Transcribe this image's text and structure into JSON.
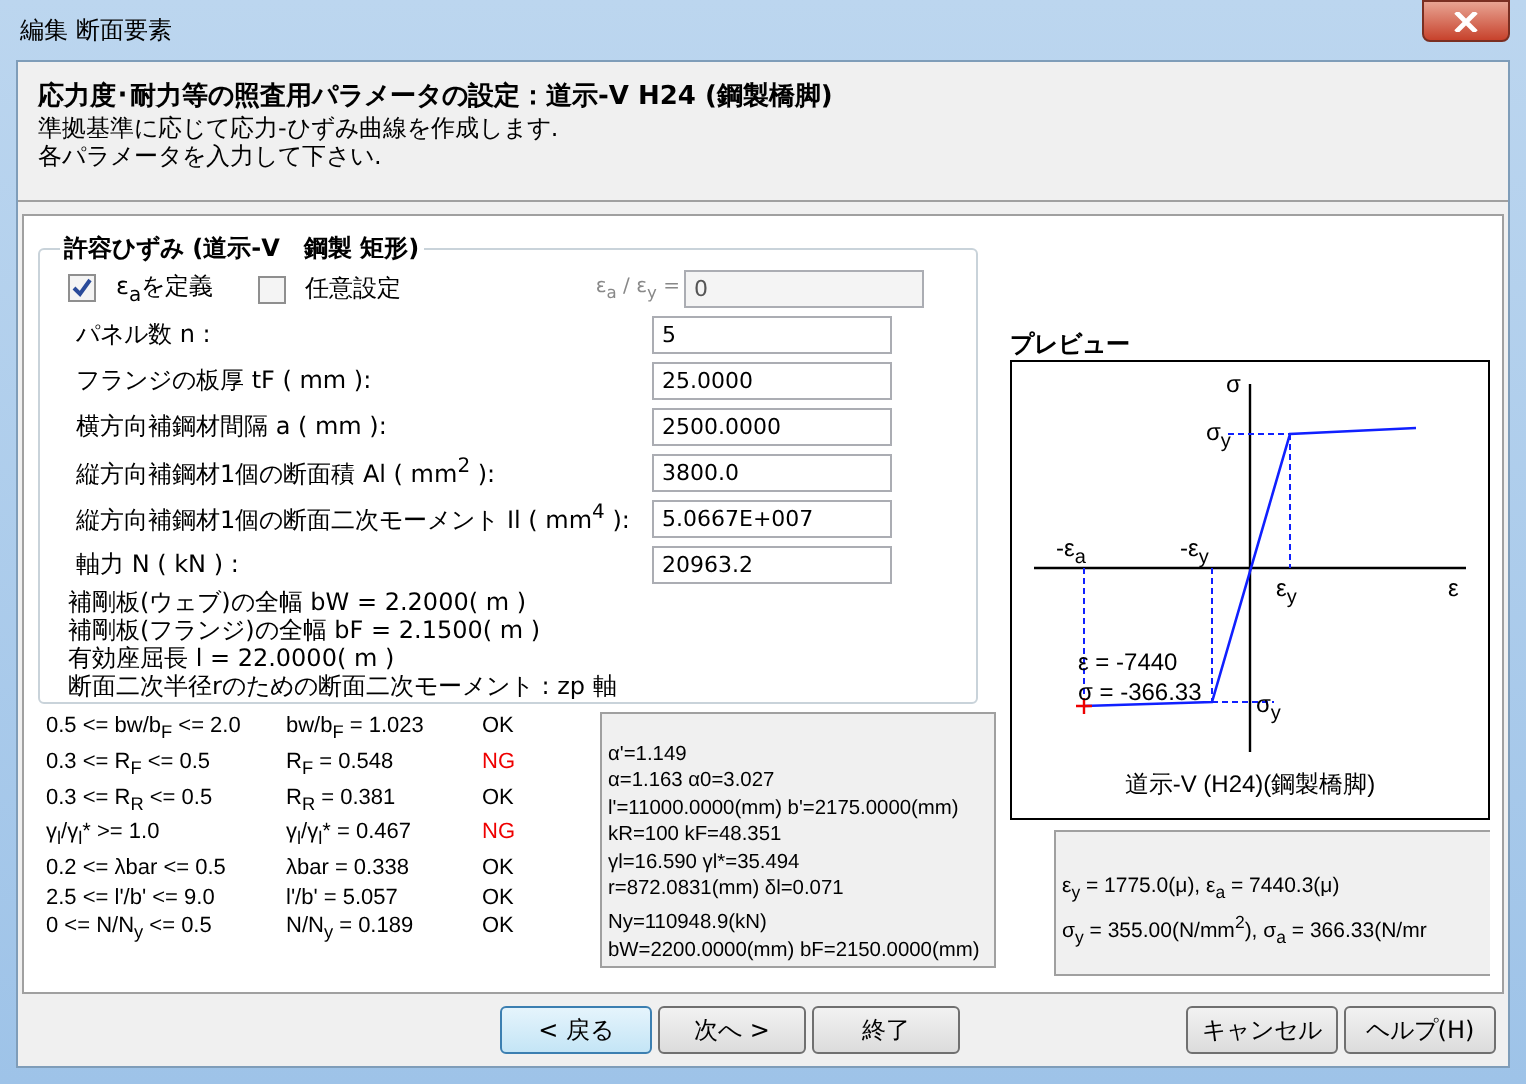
{
  "window": {
    "title": "編集 断面要素"
  },
  "header": {
    "title": "応力度･耐力等の照査用パラメータの設定：道示-V H24 (鋼製橋脚)",
    "lines": [
      "準拠基準に応じて応力-ひずみ曲線を作成します.",
      "各パラメータを入力して下さい."
    ]
  },
  "group": {
    "title": "許容ひずみ (道示-V　鋼製 矩形)",
    "options": [
      {
        "label": "ε$_{a}$を定義",
        "checked": true
      },
      {
        "label": "任意設定",
        "checked": false
      }
    ],
    "ratio": {
      "label": "ε$_{a}$ / ε$_{y}$ =",
      "value": "0",
      "disabled": true
    },
    "fields": [
      {
        "label": "パネル数 n :",
        "value": "5"
      },
      {
        "label": "フランジの板厚 tF ( mm ):",
        "value": "25.0000"
      },
      {
        "label": "横方向補鋼材間隔 a ( mm ):",
        "value": "2500.0000"
      },
      {
        "label": "縦方向補鋼材1個の断面積 Al ( mm$^{2}$ ):",
        "value": "3800.0"
      },
      {
        "label": "縦方向補鋼材1個の断面二次モーメント Il ( mm$^{4}$ ):",
        "value": "5.0667E+007"
      },
      {
        "label": "軸力 N ( kN ) :",
        "value": "20963.2"
      }
    ],
    "notes": [
      "補剛板(ウェブ)の全幅 bW = 2.2000( m )",
      "補剛板(フランジ)の全幅 bF = 2.1500( m )",
      "有効座屈長 l = 22.0000( m )",
      "断面二次半径rのための断面二次モーメント : zp 軸"
    ]
  },
  "checks": [
    {
      "condition": "0.5 <= bw/b$_{F}$ <= 2.0",
      "value": "bw/b$_{F}$ = 1.023",
      "result": "OK",
      "pass": true
    },
    {
      "condition": "0.3 <= R$_{F}$ <= 0.5",
      "value": "R$_{F}$ = 0.548",
      "result": "NG",
      "pass": false
    },
    {
      "condition": "0.3 <= R$_{R}$ <= 0.5",
      "value": "R$_{R}$ = 0.381",
      "result": "OK",
      "pass": true
    },
    {
      "condition": "γ$_{l}$/γ$_{l}$* >= 1.0",
      "value": "γ$_{l}$/γ$_{l}$* = 0.467",
      "result": "NG",
      "pass": false
    },
    {
      "condition": "0.2 <= λbar <= 0.5",
      "value": "λbar = 0.338",
      "result": "OK",
      "pass": true
    },
    {
      "condition": "2.5 <= l'/b' <= 9.0",
      "value": "l'/b' = 5.057",
      "result": "OK",
      "pass": true
    },
    {
      "condition": "0 <= N/N$_{y}$ <= 0.5",
      "value": "N/N$_{y}$ = 0.189",
      "result": "OK",
      "pass": true
    }
  ],
  "parameters": [
    "α'=1.149",
    "α=1.163 α0=3.027",
    "l'=11000.0000(mm) b'=2175.0000(mm)",
    "kR=100 kF=48.351",
    "γl=16.590 γl*=35.494",
    "r=872.0831(mm) δl=0.071",
    "Ny=110948.9(kN)",
    "bW=2200.0000(mm) bF=2150.0000(mm)"
  ],
  "preview": {
    "title": "プレビュー",
    "labels": [
      "σ",
      "σ$_{y}$",
      "-ε$_{a}$",
      "-ε$_{y}$",
      "ε$_{y}$",
      "ε",
      "σ$_{y}$"
    ],
    "annotations": [
      "ε = -7440",
      "σ = -366.33"
    ],
    "caption": "道示-V (H24)(鋼製橋脚)"
  },
  "summary": [
    "ε$_{y}$ = 1775.0(μ), ε$_{a}$ = 7440.3(μ)",
    "σ$_{y}$ = 355.00(N/mm$^{2}$), σ$_{a}$ = 366.33(N/mr"
  ],
  "buttons": [
    {
      "label": "< 戻る",
      "selected": true
    },
    {
      "label": "次へ >",
      "selected": false
    },
    {
      "label": "終了",
      "selected": false
    }
  ],
  "side_buttons": [
    "キャンセル",
    "ヘルプ(H)"
  ]
}
